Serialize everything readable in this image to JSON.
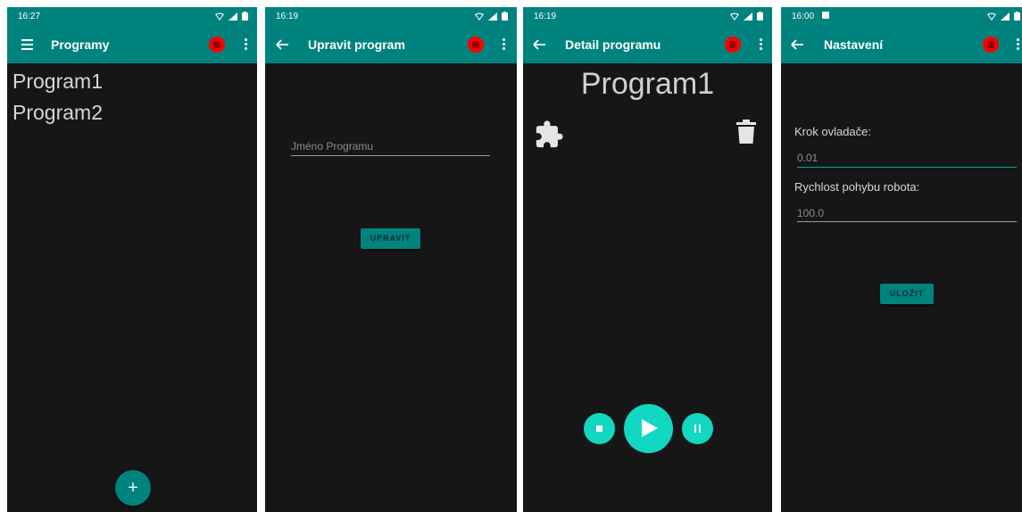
{
  "screens": [
    {
      "status_time": "16:27",
      "title": "Programy",
      "programs": [
        "Program1",
        "Program2"
      ],
      "fab_label": "+"
    },
    {
      "status_time": "16:19",
      "title": "Upravit program",
      "name_placeholder": "Jméno Programu",
      "edit_button": "UPRAVIT"
    },
    {
      "status_time": "16:19",
      "title": "Detail programu",
      "program_name": "Program1"
    },
    {
      "status_time": "16:00",
      "title": "Nastavení",
      "step_label": "Krok ovladače:",
      "step_value": "0.01",
      "speed_label": "Rychlost pohybu robota:",
      "speed_value": "100.0",
      "save_button": "ULOŽIT"
    }
  ],
  "colors": {
    "appbar": "#00837f",
    "background": "#161616",
    "accent": "#12d7c1",
    "record": "#ff0000"
  },
  "icons": [
    "menu-icon",
    "back-arrow-icon",
    "record-icon",
    "more-vert-icon",
    "puzzle-icon",
    "trash-icon",
    "stop-icon",
    "play-icon",
    "pause-icon",
    "wifi-icon",
    "signal-icon",
    "battery-icon"
  ]
}
